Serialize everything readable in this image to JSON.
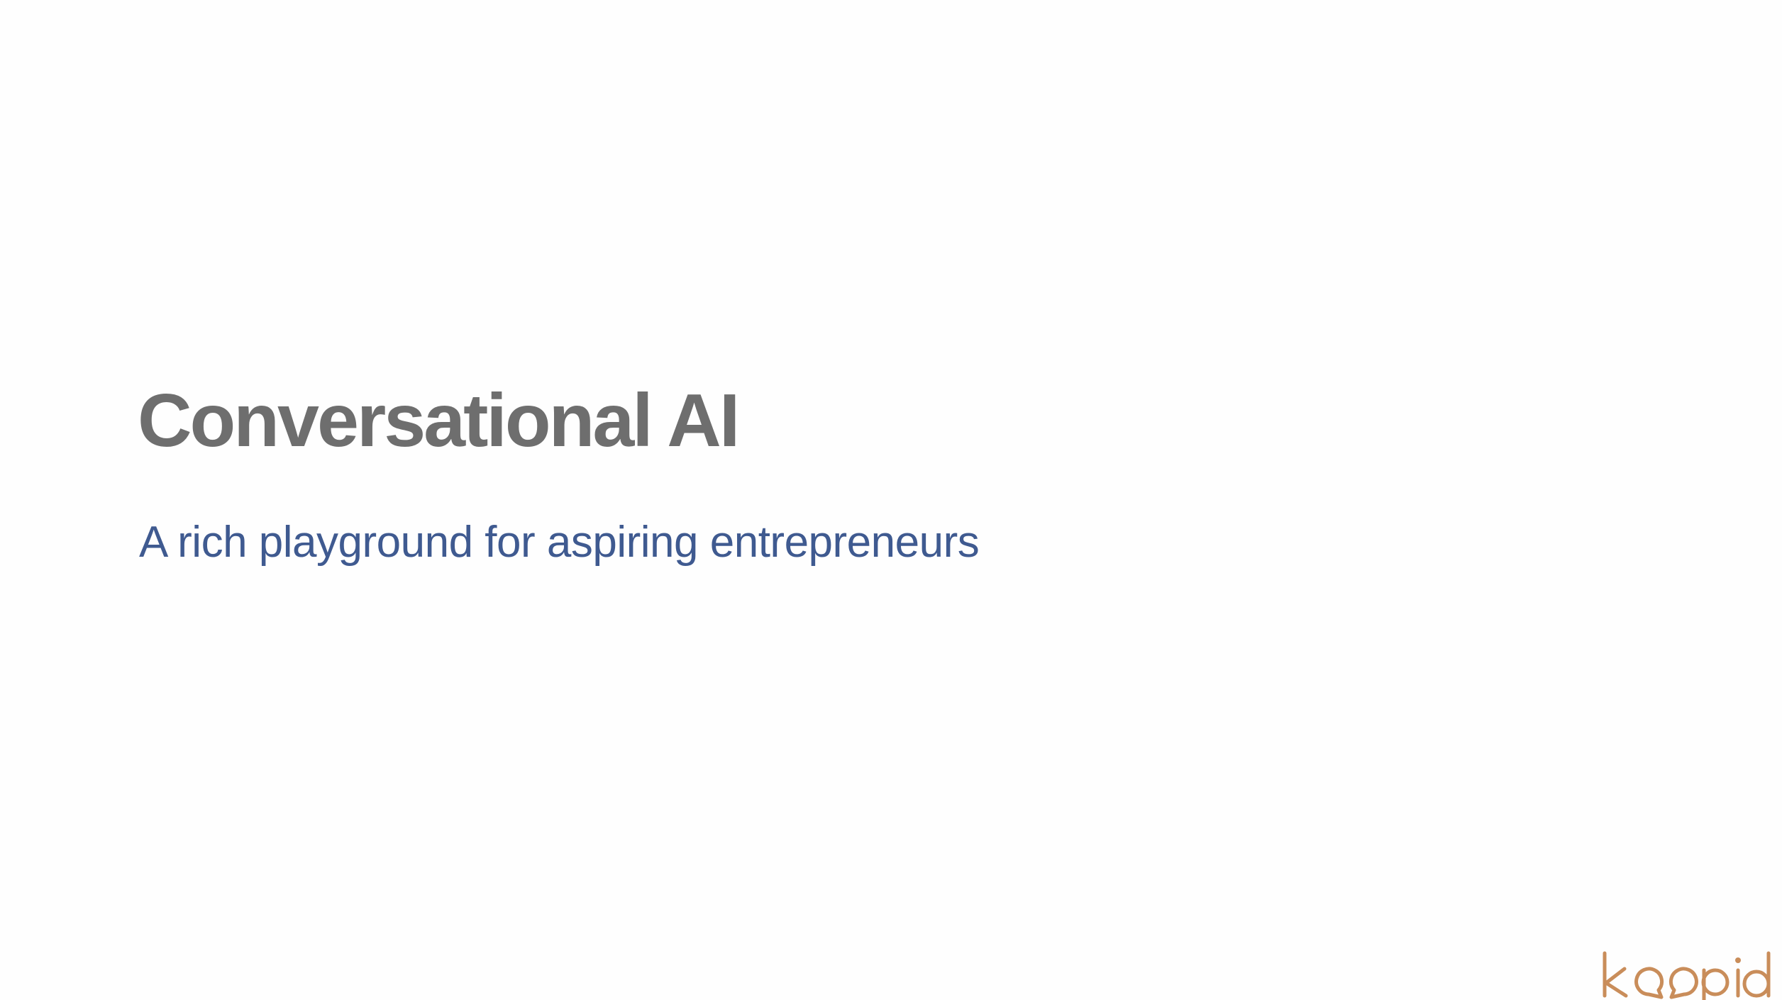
{
  "slide": {
    "title": "Conversational AI",
    "subtitle": "A rich playground for aspiring entrepreneurs"
  },
  "logo": {
    "text": "koopid",
    "icon": "koopid-logo"
  },
  "colors": {
    "background": "#fefefe",
    "title": "#6e6e6e",
    "subtitle": "#3f5a90",
    "logo": "#c98d5a"
  }
}
